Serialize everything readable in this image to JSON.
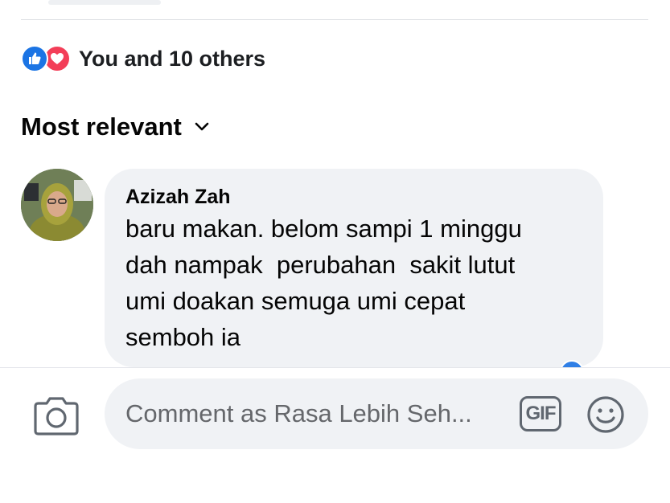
{
  "reactions": {
    "summary": "You and 10 others",
    "icons": [
      "like-icon",
      "love-icon"
    ],
    "like_color": "#1b74e4",
    "love_color": "#f33e58"
  },
  "sort": {
    "label": "Most relevant",
    "icon": "chevron-down-icon"
  },
  "comment": {
    "author": "Azizah Zah",
    "lines": [
      "baru makan. belom sampi 1 minggu",
      "dah nampak  perubahan  sakit lutut",
      "umi doakan semuga umi cepat",
      "semboh ia"
    ]
  },
  "composer": {
    "placeholder": "Comment as Rasa Lebih Seh...",
    "gif_label": "GIF",
    "camera_icon": "camera-icon",
    "emoji_icon": "smiley-icon"
  },
  "colors": {
    "bubble_bg": "#f0f2f5",
    "text": "#050505",
    "muted": "#65676b"
  }
}
